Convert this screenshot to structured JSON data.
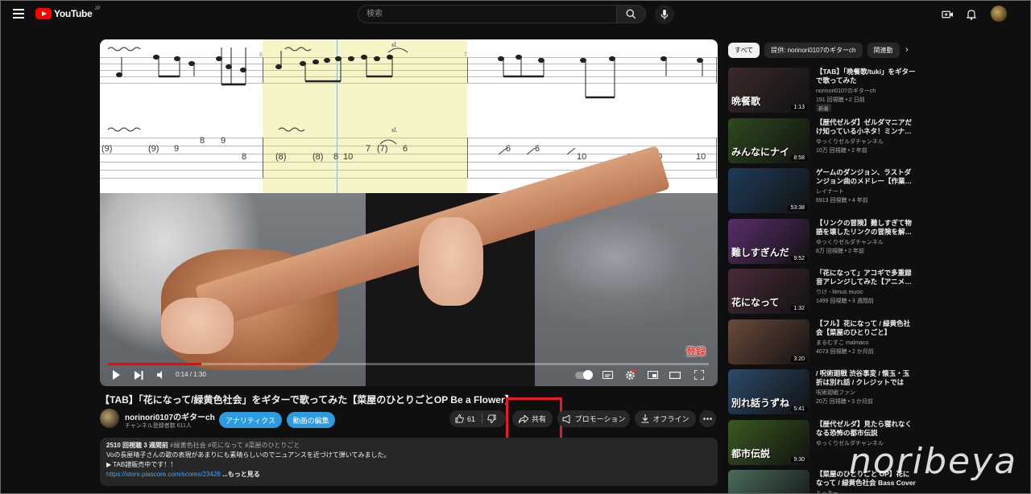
{
  "header": {
    "logo_text": "YouTube",
    "logo_region": "JP",
    "search_placeholder": "検索"
  },
  "player": {
    "measure_numbers": [
      "6",
      "7"
    ],
    "slide_marks": [
      "sl.",
      "sl."
    ],
    "tab_row1": [
      "(9)",
      "(9)",
      "9",
      "8",
      "9",
      "8"
    ],
    "tab_row2": [
      "(8)",
      "(8)",
      "8",
      "10",
      "7",
      "(7)",
      "6",
      "6",
      "6",
      "10",
      "10",
      "10",
      "10"
    ],
    "overlay_label": "登録",
    "time": "0:14 / 1:30",
    "progress": 0.156
  },
  "video": {
    "title": "【TAB】「花になって/緑黄色社会」をギターで歌ってみた【菜屋のひとりごとOP Be a Flower】",
    "channel_name": "norinori0107のギターch",
    "channel_subs": "チャンネル登録者数 611人",
    "btn_analytics": "アナリティクス",
    "btn_edit": "動画の編集",
    "likes": "61",
    "btn_share": "共有",
    "btn_promo": "プロモーション",
    "btn_offline": "オフライン"
  },
  "description": {
    "meta": "2510 回視聴  3 週間前",
    "tags": "#緑黄色社会 #花になって #菜屋のひとりごと",
    "line1": "Voの長屋晴子さんの歌の表現があまりにも素晴らしいのでニュアンスを近づけて弾いてみました。",
    "line2": "▶ TAB譜販売中です！！",
    "link": "https://store.piascore.com/scores/23428",
    "more": "...もっと見る"
  },
  "sidebar": {
    "chips": [
      "すべて",
      "提供: norinori0107のギターch",
      "関連動"
    ],
    "recs": [
      {
        "title": "【TAB】「晩餐歌/tuki」をギターで歌ってみた",
        "channel": "norinori0107のギターch",
        "meta": "191 回視聴 • 2 日前",
        "badge": "新着",
        "duration": "1:13",
        "thumb_text": "晩餐歌",
        "color": "#3b2a2a"
      },
      {
        "title": "【歴代ゼルダ】ゼルダマニアだけ知っている小ネタ！ミンナ…",
        "channel": "ゆっくりゼルダチャンネル",
        "meta": "10万 回視聴 • 2 年前",
        "badge": "",
        "duration": "8:58",
        "thumb_text": "みんなにナイ",
        "color": "#2e4a1f"
      },
      {
        "title": "ゲームのダンジョン、ラストダンジョン曲のメドレー【作業…",
        "channel": "レイナート",
        "meta": "6913 回視聴 • 4 年前",
        "badge": "",
        "duration": "53:38",
        "thumb_text": "",
        "color": "#1f3b5a"
      },
      {
        "title": "【リンクの冒険】難しすぎて物語を壊したリンクの冒険を解…",
        "channel": "ゆっくりゼルダチャンネル",
        "meta": "8万 回視聴 • 2 年前",
        "badge": "",
        "duration": "9:52",
        "thumb_text": "難しすぎんだ",
        "color": "#5a2e6b"
      },
      {
        "title": "「花になって」アコギで多重録音アレンジしてみた【アニメ…",
        "channel": "りけ - litmus music",
        "meta": "1499 回視聴 • 3 週間前",
        "badge": "",
        "duration": "1:32",
        "thumb_text": "花になって",
        "color": "#4a2b3a"
      },
      {
        "title": "【フル】花になって / 緑黄色社会【菜屋のひとりごと】guitar…",
        "channel": "まるむすこ malmaco",
        "meta": "4073 回視聴 • 2 か月前",
        "badge": "",
        "duration": "3:20",
        "thumb_text": "",
        "color": "#6b4a3a"
      },
      {
        "title": "/ 呪術廻戦 渋谷事変 / 懐玉・玉折は別れ話 / クレジットでは五…",
        "channel": "呪術廻戦ファン",
        "meta": "20万 回視聴 • 3 か月前",
        "badge": "",
        "duration": "5:41",
        "thumb_text": "別れ話うずね",
        "color": "#2b4a6b"
      },
      {
        "title": "【歴代ゼルダ】見たら寝れなくなる恐怖の都市伝説",
        "channel": "ゆっくりゼルダチャンネル",
        "meta": "",
        "badge": "",
        "duration": "9:30",
        "thumb_text": "都市伝説",
        "color": "#3a5a1f"
      },
      {
        "title": "【菜屋のひとりごと OP】花になって / 緑黄色社会 Bass Cover",
        "channel": "とっきー",
        "meta": "",
        "badge": "",
        "duration": "",
        "thumb_text": "",
        "color": "#4a6b5a"
      }
    ]
  },
  "watermark": "noribeya"
}
